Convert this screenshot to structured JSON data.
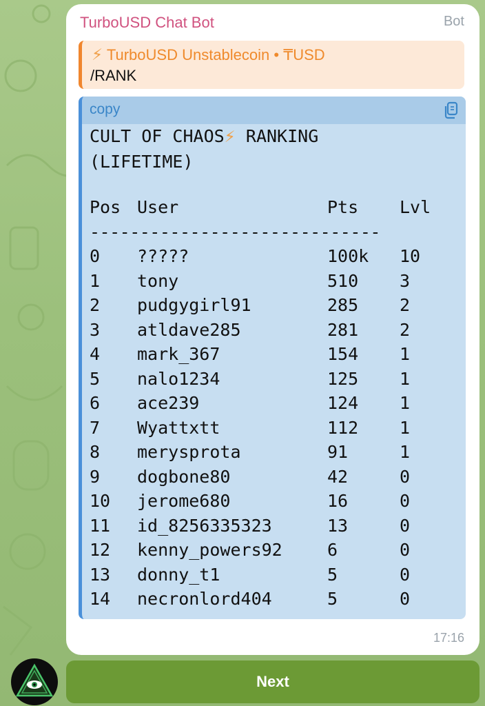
{
  "message": {
    "sender": "TurboUSD Chat Bot",
    "tag": "Bot",
    "reply": {
      "title": "TurboUSD Unstablecoin • ₸USD",
      "text": "/RANK"
    },
    "code": {
      "lang_label": "copy",
      "title_line1": "CULT OF CHAOS",
      "title_line1b": "RANKING",
      "title_line2": "(LIFETIME)",
      "headers": {
        "pos": "Pos",
        "user": "User",
        "pts": "Pts",
        "lvl": "Lvl"
      },
      "rule": "-----------------------------",
      "rows": [
        {
          "pos": "0",
          "user": "?????",
          "pts": "100k",
          "lvl": "10"
        },
        {
          "pos": "1",
          "user": "tony",
          "pts": "510",
          "lvl": "3"
        },
        {
          "pos": "2",
          "user": "pudgygirl91",
          "pts": "285",
          "lvl": "2"
        },
        {
          "pos": "3",
          "user": "atldave285",
          "pts": "281",
          "lvl": "2"
        },
        {
          "pos": "4",
          "user": "mark_367",
          "pts": "154",
          "lvl": "1"
        },
        {
          "pos": "5",
          "user": "nalo1234",
          "pts": "125",
          "lvl": "1"
        },
        {
          "pos": "6",
          "user": "ace239",
          "pts": "124",
          "lvl": "1"
        },
        {
          "pos": "7",
          "user": "Wyattxtt",
          "pts": "112",
          "lvl": "1"
        },
        {
          "pos": "8",
          "user": "merysprota",
          "pts": "91",
          "lvl": "1"
        },
        {
          "pos": "9",
          "user": "dogbone80",
          "pts": "42",
          "lvl": "0"
        },
        {
          "pos": "10",
          "user": "jerome680",
          "pts": "16",
          "lvl": "0"
        },
        {
          "pos": "11",
          "user": "id_8256335323",
          "pts": "13",
          "lvl": "0"
        },
        {
          "pos": "12",
          "user": "kenny_powers92",
          "pts": "6",
          "lvl": "0"
        },
        {
          "pos": "13",
          "user": "donny_t1",
          "pts": "5",
          "lvl": "0"
        },
        {
          "pos": "14",
          "user": "necronlord404",
          "pts": "5",
          "lvl": "0"
        }
      ]
    },
    "time": "17:16"
  },
  "next_button": {
    "label": "Next"
  },
  "icons": {
    "copy": "copy-icon",
    "bolt": "lightning-bolt-icon",
    "avatar": "eye-triangle-icon"
  },
  "colors": {
    "sender": "#d0527f",
    "reply_accent": "#f0862e",
    "code_accent": "#4a90d9",
    "button": "#6c9a35"
  }
}
